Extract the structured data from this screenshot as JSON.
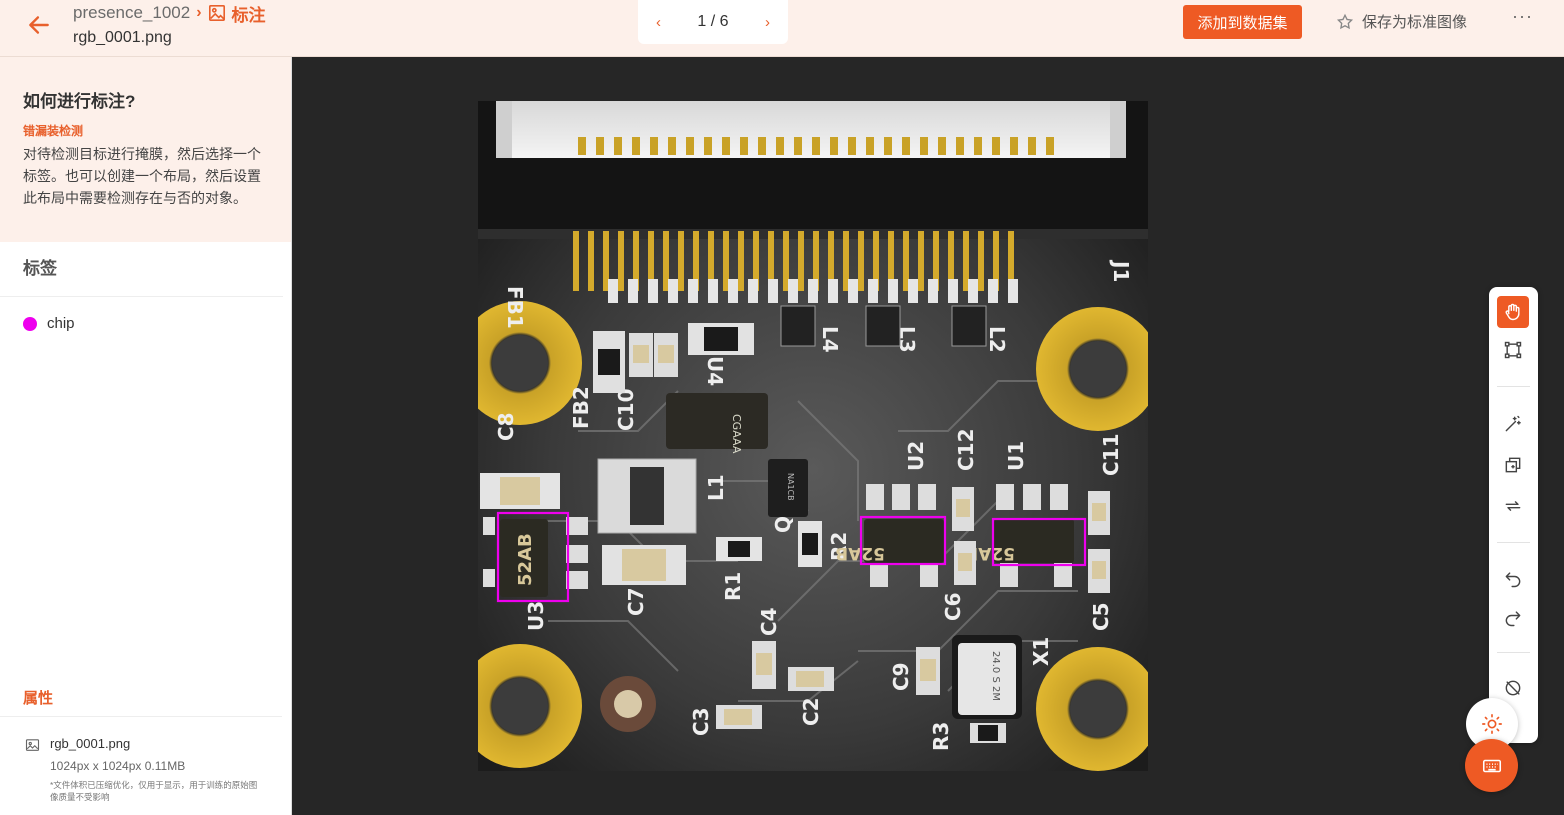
{
  "header": {
    "project": "presence_1002",
    "section": "标注",
    "filename": "rgb_0001.png",
    "pager": "1 / 6",
    "add_dataset_label": "添加到数据集",
    "save_standard_label": "保存为标准图像",
    "more_label": "···"
  },
  "guide": {
    "title": "如何进行标注?",
    "subtitle": "错漏装检测",
    "description": "对待检测目标进行掩膜，然后选择一个标签。也可以创建一个布局，然后设置此布局中需要检测存在与否的对象。"
  },
  "labels": {
    "heading": "标签",
    "items": [
      {
        "name": "chip",
        "color": "#ee00ee"
      }
    ]
  },
  "properties": {
    "heading": "属性",
    "file_name": "rgb_0001.png",
    "file_meta": "1024px x 1024px 0.11MB",
    "note": "*文件体积已压缩优化，仅用于显示，用于训练的原始图像质量不受影响"
  },
  "image": {
    "chip_marking": "52AB",
    "chip_marking_small": "CGAAA",
    "components": {
      "fb1": "FB1",
      "j1": "J1",
      "l4": "L4",
      "l3": "L3",
      "l2": "L2",
      "u4": "U4",
      "c8": "C8",
      "fb2": "FB2",
      "c10": "C10",
      "c12": "C12",
      "u2": "U2",
      "u1": "U1",
      "c11": "C11",
      "l1": "L1",
      "q1": "Q1",
      "r2": "R2",
      "r1": "R1",
      "c7": "C7",
      "u3": "U3",
      "c4": "C4",
      "c6": "C6",
      "c5": "C5",
      "x1": "X1",
      "c9": "C9",
      "c2": "C2",
      "c3": "C3",
      "r3": "R3",
      "ic_small": "NA1CB",
      "crystal": "24.0 S 2M"
    }
  }
}
